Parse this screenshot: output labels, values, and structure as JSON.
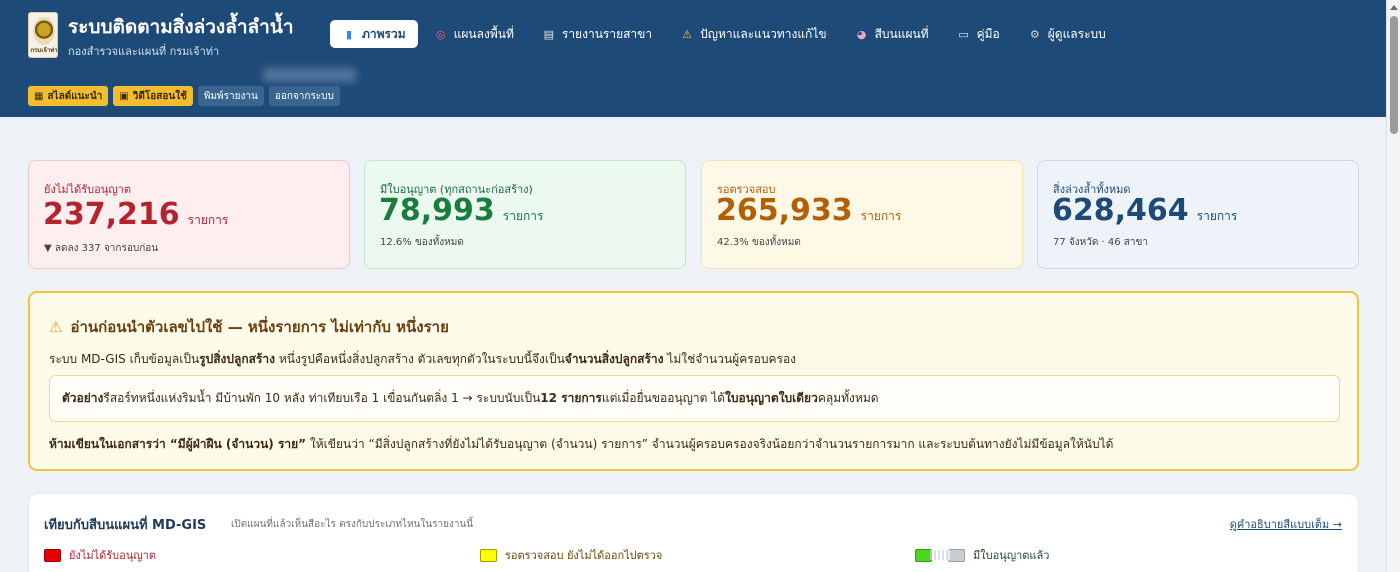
{
  "header": {
    "title": "ระบบติดตามสิ่งล่วงล้ำลำน้ำ",
    "subtitle": "กองสำรวจและแผนที่ กรมเจ้าท่า",
    "logo_text": "กรมเจ้าท่า"
  },
  "nav": [
    {
      "label": "ภาพรวม",
      "icon": "bar-chart-icon",
      "glyph": "▮",
      "active": true
    },
    {
      "label": "แผนลงพื้นที่",
      "icon": "target-icon",
      "glyph": "◎",
      "active": false
    },
    {
      "label": "รายงานรายสาขา",
      "icon": "document-icon",
      "glyph": "▤",
      "active": false
    },
    {
      "label": "ปัญหาและแนวทางแก้ไข",
      "icon": "warning-icon",
      "glyph": "⚠",
      "active": false
    },
    {
      "label": "สีบนแผนที่",
      "icon": "palette-icon",
      "glyph": "◕",
      "active": false
    },
    {
      "label": "คู่มือ",
      "icon": "book-icon",
      "glyph": "▭",
      "active": false
    },
    {
      "label": "ผู้ดูแลระบบ",
      "icon": "gear-icon",
      "glyph": "⚙",
      "active": false
    }
  ],
  "toolbar": {
    "slides": "สไลด์แนะนำ",
    "video": "วิดีโอสอนใช้",
    "print": "พิมพ์รายงาน",
    "logout": "ออกจากระบบ"
  },
  "stats": {
    "unlicensed": {
      "label": "ยังไม่ได้รับอนุญาต",
      "value": "237,216",
      "unit": "รายการ",
      "note": "▼ ลดลง 337 จากรอบก่อน"
    },
    "licensed": {
      "label": "มีใบอนุญาต (ทุกสถานะก่อสร้าง)",
      "value": "78,993",
      "unit": "รายการ",
      "note": "12.6% ของทั้งหมด"
    },
    "pending": {
      "label": "รอตรวจสอบ",
      "value": "265,933",
      "unit": "รายการ",
      "note": "42.3% ของทั้งหมด"
    },
    "total": {
      "label": "สิ่งล่วงล้ำทั้งหมด",
      "value": "628,464",
      "unit": "รายการ",
      "note": "77 จังหวัด · 46 สาขา"
    }
  },
  "warning": {
    "title": "อ่านก่อนนำตัวเลขไปใช้ — หนึ่งรายการ ไม่เท่ากับ หนึ่งราย",
    "p1_a": "ระบบ MD-GIS เก็บข้อมูลเป็น",
    "p1_b": "รูปสิ่งปลูกสร้าง",
    "p1_c": " หนึ่งรูปคือหนึ่งสิ่งปลูกสร้าง ตัวเลขทุกตัวในระบบนี้จึงเป็น",
    "p1_d": "จำนวนสิ่งปลูกสร้าง",
    "p1_e": " ไม่ใช่จำนวนผู้ครอบครอง",
    "ex_a": "ตัวอย่าง",
    "ex_b": " รีสอร์ทหนึ่งแห่งริมน้ำ มีบ้านพัก 10 หลัง ท่าเทียบเรือ 1 เขื่อนกันตลิ่ง 1 → ระบบนับเป็น ",
    "ex_c": "12 รายการ",
    "ex_d": " แต่เมื่อยื่นขออนุญาต ได้",
    "ex_e": "ใบอนุญาตใบเดียว",
    "ex_f": "คลุมทั้งหมด",
    "p2_a": "ห้ามเขียนในเอกสารว่า “มีผู้ฝ่าฝืน (จำนวน) ราย”",
    "p2_b": " ให้เขียนว่า “มีสิ่งปลูกสร้างที่ยังไม่ได้รับอนุญาต (จำนวน) รายการ” จำนวนผู้ครอบครองจริงน้อยกว่าจำนวนรายการมาก และระบบต้นทางยังไม่มีข้อมูลให้นับได้"
  },
  "legend": {
    "title": "เทียบกับสีบนแผนที่ MD-GIS",
    "subtitle": "เปิดแผนที่แล้วเห็นสีอะไร ตรงกับประเภทไหนในรายงานนี้",
    "link": "ดูคำอธิบายสีแบบเต็ม →",
    "items": [
      {
        "label": "ยังไม่ได้รับอนุญาต",
        "color": "#e60000"
      },
      {
        "label": "รอตรวจสอบ ยังไม่ได้ออกไปตรวจ",
        "color": "#ffff00"
      },
      {
        "label": "มีใบอนุญาตแล้ว",
        "color": "#4cd61f",
        "color2": "#c9ccd1"
      }
    ]
  }
}
